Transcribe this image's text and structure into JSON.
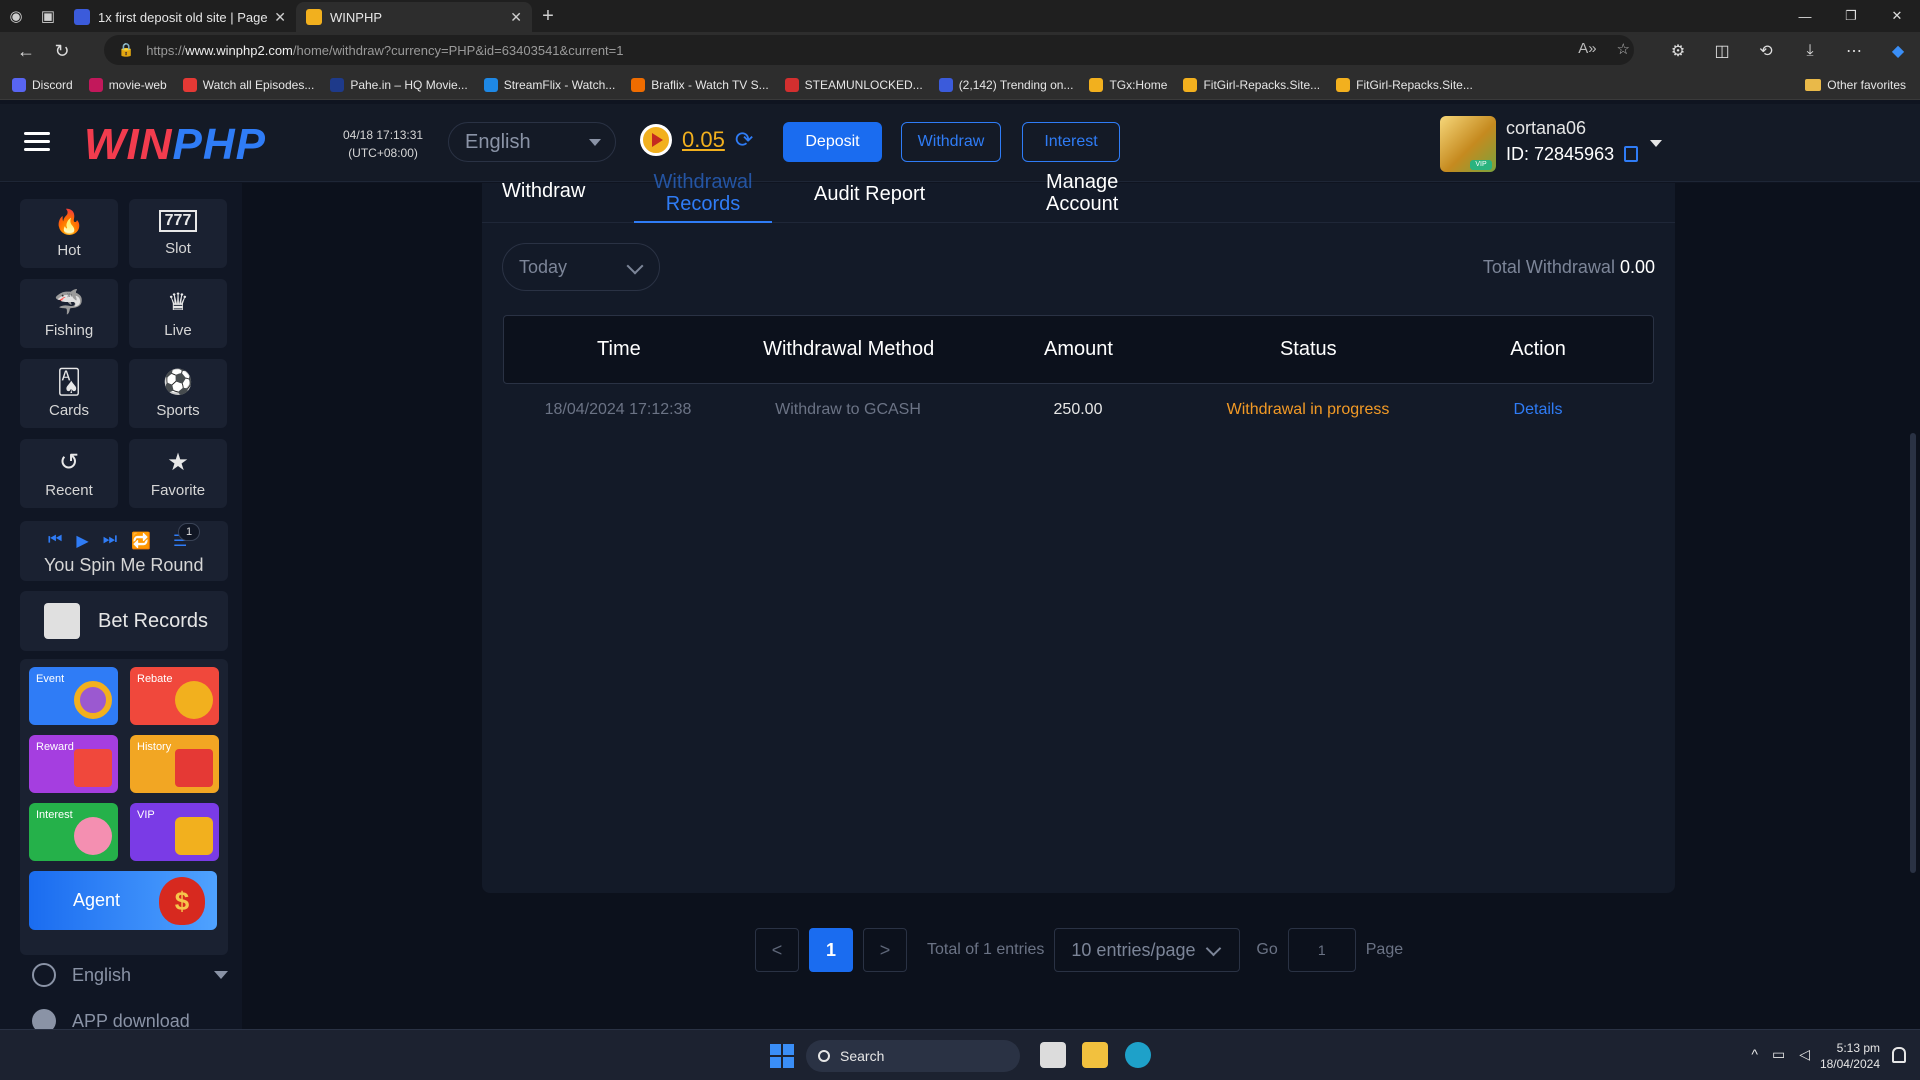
{
  "browser": {
    "tabs": [
      {
        "title": "1x first deposit old site | Page 2 |",
        "active": false
      },
      {
        "title": "WINPHP",
        "active": true
      }
    ],
    "url_prefix": "https://",
    "url_domain": "www.winphp2.com",
    "url_path": "/home/withdraw?currency=PHP&id=63403541&current=1",
    "bookmarks": [
      "Discord",
      "movie-web",
      "Watch all Episodes...",
      "Pahe.in – HQ Movie...",
      "StreamFlix - Watch...",
      "Braflix - Watch TV S...",
      "STEAMUNLOCKED...",
      "(2,142) Trending on...",
      "TGx:Home",
      "FitGirl-Repacks.Site...",
      "FitGirl-Repacks.Site..."
    ],
    "other_favorites": "Other favorites"
  },
  "header": {
    "logo_w": "WIN",
    "logo_p": "PHP",
    "clock_date": "04/18 17:13:31",
    "clock_tz": "(UTC+08:00)",
    "language": "English",
    "balance": "0.05",
    "deposit_label": "Deposit",
    "withdraw_label": "Withdraw",
    "interest_label": "Interest",
    "username": "cortana06",
    "user_id": "ID: 72845963",
    "vip_badge": "VIP"
  },
  "sidebar": {
    "categories": [
      {
        "label": "Hot",
        "icon": "🔥"
      },
      {
        "label": "Slot",
        "icon": "777"
      },
      {
        "label": "Fishing",
        "icon": "🦈"
      },
      {
        "label": "Live",
        "icon": "♛"
      },
      {
        "label": "Cards",
        "icon": "🂡"
      },
      {
        "label": "Sports",
        "icon": "⚽"
      },
      {
        "label": "Recent",
        "icon": "↺"
      },
      {
        "label": "Favorite",
        "icon": "★"
      }
    ],
    "music_badge": "1",
    "song": "You Spin Me Round",
    "bet_records": "Bet Records",
    "promos": [
      {
        "label": "Event",
        "color": "#2f7cf6"
      },
      {
        "label": "Rebate",
        "color": "#f0483c"
      },
      {
        "label": "Reward",
        "color": "#a53ee0"
      },
      {
        "label": "History",
        "color": "#f2a623"
      },
      {
        "label": "Interest",
        "color": "#25b14a"
      },
      {
        "label": "VIP",
        "color": "#7a3be6"
      }
    ],
    "agent": "Agent",
    "agent_icon": "$",
    "language": "English",
    "app_download": "APP download"
  },
  "main": {
    "tabs": {
      "withdraw": "Withdraw",
      "records_top": "Withdrawal",
      "records_bottom": "Records",
      "audit": "Audit Report",
      "manage_top": "Manage",
      "manage_bottom": "Account"
    },
    "filter": "Today",
    "total_label": "Total Withdrawal",
    "total_value": "0.00",
    "columns": [
      "Time",
      "Withdrawal Method",
      "Amount",
      "Status",
      "Action"
    ],
    "rows": [
      {
        "time": "18/04/2024 17:12:38",
        "method": "Withdraw to GCASH",
        "amount": "250.00",
        "status": "Withdrawal in progress",
        "action": "Details"
      }
    ],
    "pager": {
      "prev": "<",
      "current": "1",
      "next": ">",
      "total": "Total of 1 entries",
      "per_page": "10 entries/page",
      "go": "Go",
      "go_value": "1",
      "page": "Page"
    }
  },
  "taskbar": {
    "search": "Search",
    "time": "5:13 pm",
    "date": "18/04/2024"
  }
}
